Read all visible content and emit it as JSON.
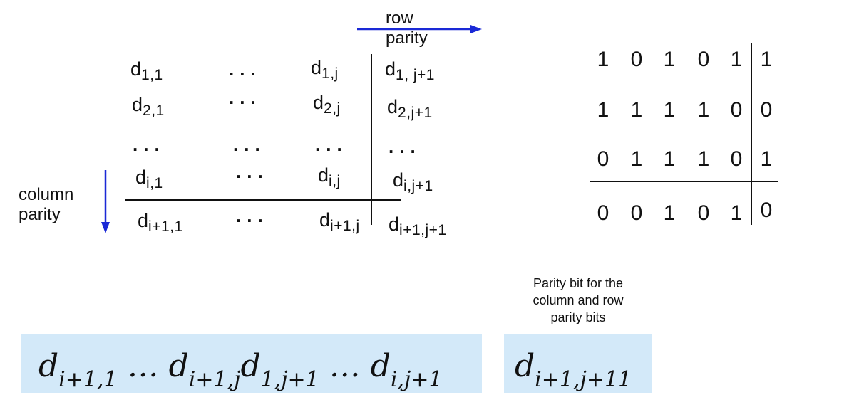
{
  "labels": {
    "row_parity": [
      "row",
      "parity"
    ],
    "column_parity": [
      "column",
      "parity"
    ],
    "caption": [
      "Parity bit for the",
      "column and row",
      "parity bits"
    ]
  },
  "matrix": {
    "symbol": "d",
    "dots": "...",
    "rows": [
      [
        "1,1",
        "1,j",
        "1, j+1"
      ],
      [
        "2,1",
        "2,j",
        "2,j+1"
      ],
      [
        "i,1",
        "i,j",
        "i,j+1"
      ]
    ],
    "last_row": [
      "i+1,1",
      "i+1,j",
      "i+1,j+1"
    ]
  },
  "example": {
    "rows": [
      {
        "data": [
          "1",
          "0",
          "1",
          "0",
          "1"
        ],
        "parity": "1"
      },
      {
        "data": [
          "1",
          "1",
          "1",
          "1",
          "0"
        ],
        "parity": "0"
      },
      {
        "data": [
          "0",
          "1",
          "1",
          "1",
          "0"
        ],
        "parity": "1"
      }
    ],
    "column_parity": {
      "data": [
        "0",
        "0",
        "1",
        "0",
        "1"
      ],
      "parity": "0"
    }
  },
  "sequence": {
    "parts": [
      {
        "d": "d",
        "sub": "i+1,1"
      },
      {
        "ellipsis": " … "
      },
      {
        "d": "d",
        "sub": "i+1,j"
      },
      {
        "d": "d",
        "sub": "1,j+1"
      },
      {
        "ellipsis": " … "
      },
      {
        "d": "d",
        "sub": "i,j+1"
      }
    ],
    "final": {
      "d": "d",
      "sub": "i+1,j+11"
    }
  },
  "colors": {
    "arrow": "#1a29d6",
    "box": "#d3e9f9",
    "text": "#111111"
  }
}
